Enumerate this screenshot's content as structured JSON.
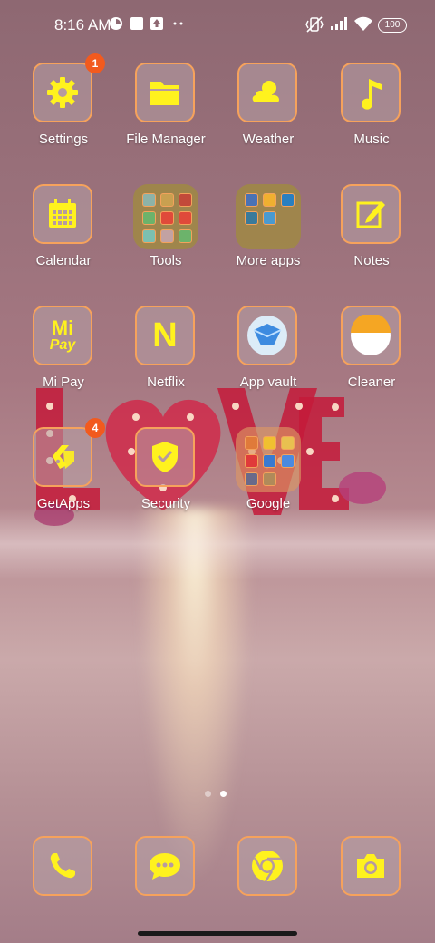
{
  "status_bar": {
    "time": "8:16 AM",
    "battery": "100",
    "icons": [
      "data-saver-icon",
      "square-notification-icon",
      "upload-icon",
      "more-dots-icon",
      "vibrate-icon",
      "signal-icon",
      "wifi-icon",
      "battery-icon"
    ]
  },
  "apps": [
    {
      "label": "Settings",
      "icon": "gear-icon",
      "badge": "1"
    },
    {
      "label": "File Manager",
      "icon": "folder-icon"
    },
    {
      "label": "Weather",
      "icon": "cloud-sun-icon"
    },
    {
      "label": "Music",
      "icon": "music-note-icon"
    },
    {
      "label": "Calendar",
      "icon": "calendar-icon"
    },
    {
      "label": "Tools",
      "icon": "folder-group-icon"
    },
    {
      "label": "More apps",
      "icon": "folder-group-icon"
    },
    {
      "label": "Notes",
      "icon": "notes-edit-icon"
    },
    {
      "label": "Mi Pay",
      "icon": "mi-pay-icon",
      "icon_text_top": "Mi",
      "icon_text_bottom": "Pay"
    },
    {
      "label": "Netflix",
      "icon": "netflix-icon",
      "icon_text": "N"
    },
    {
      "label": "App vault",
      "icon": "app-vault-icon"
    },
    {
      "label": "Cleaner",
      "icon": "cleaner-icon"
    },
    {
      "label": "GetApps",
      "icon": "getapps-icon",
      "badge": "4"
    },
    {
      "label": "Security",
      "icon": "shield-check-icon"
    },
    {
      "label": "Google",
      "icon": "folder-group-icon"
    }
  ],
  "page_indicator": {
    "pages": 2,
    "active": 2
  },
  "dock": [
    {
      "label": "Phone",
      "icon": "phone-icon"
    },
    {
      "label": "Messaging",
      "icon": "chat-bubble-icon"
    },
    {
      "label": "Chrome",
      "icon": "chrome-icon"
    },
    {
      "label": "Camera",
      "icon": "camera-icon"
    }
  ],
  "colors": {
    "icon_yellow": "#fff21e",
    "tile_border": "#f6a25c",
    "badge": "#f25a1e"
  }
}
